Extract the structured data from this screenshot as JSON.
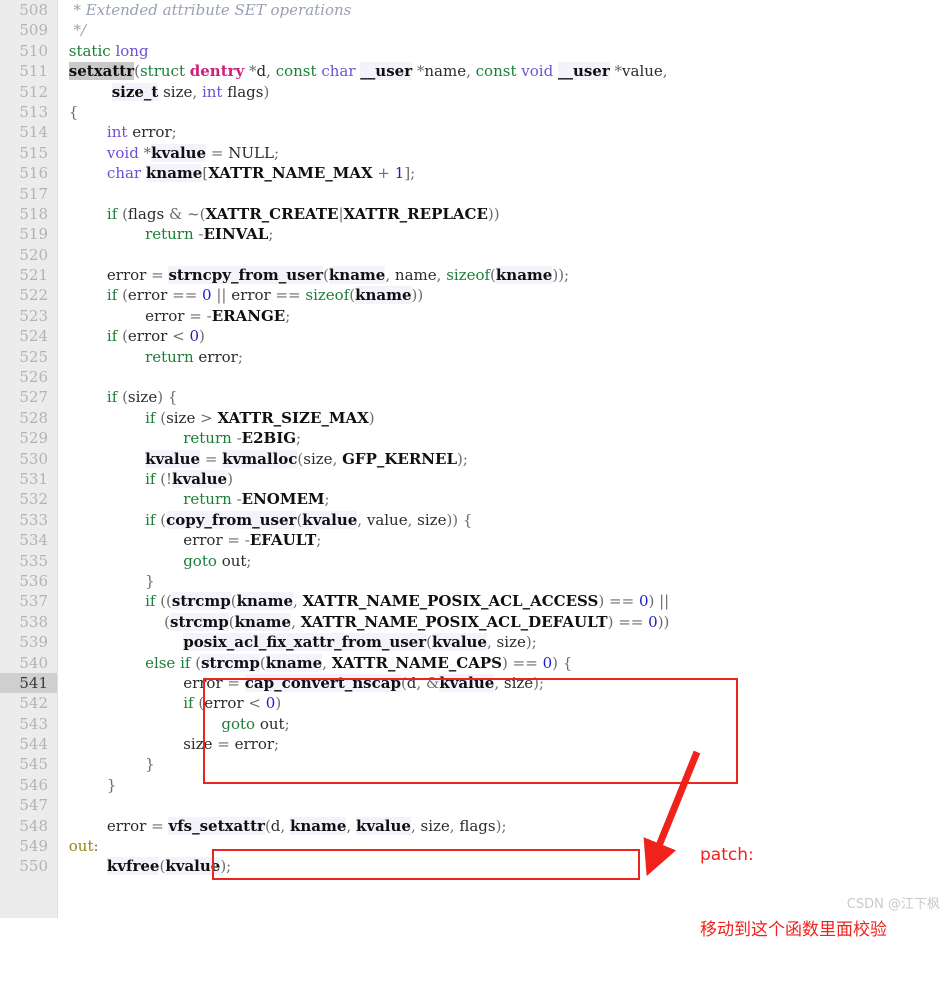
{
  "editor": {
    "language": "c",
    "first_line": 508,
    "last_line": 550,
    "current_line": 541,
    "gutter_bg": "#ececec",
    "current_line_bg": "#cfcfcf",
    "search_highlight_token": "setxattr"
  },
  "line_numbers": [
    "508",
    "509",
    "510",
    "511",
    "512",
    "513",
    "514",
    "515",
    "516",
    "517",
    "518",
    "519",
    "520",
    "521",
    "522",
    "523",
    "524",
    "525",
    "526",
    "527",
    "528",
    "529",
    "530",
    "531",
    "532",
    "533",
    "534",
    "535",
    "536",
    "537",
    "538",
    "539",
    "540",
    "541",
    "542",
    "543",
    "544",
    "545",
    "546",
    "547",
    "548",
    "549",
    "550"
  ],
  "code_lines": [
    {
      "n": "508",
      "text": "  * Extended attribute SET operations"
    },
    {
      "n": "509",
      "text": "  */"
    },
    {
      "n": "510",
      "text": " static long"
    },
    {
      "n": "511",
      "text": " setxattr(struct dentry *d, const char __user *name, const void __user *value,"
    },
    {
      "n": "512",
      "text": "          size_t size, int flags)"
    },
    {
      "n": "513",
      "text": " {"
    },
    {
      "n": "514",
      "text": "         int error;"
    },
    {
      "n": "515",
      "text": "         void *kvalue = NULL;"
    },
    {
      "n": "516",
      "text": "         char kname[XATTR_NAME_MAX + 1];"
    },
    {
      "n": "517",
      "text": ""
    },
    {
      "n": "518",
      "text": "         if (flags & ~(XATTR_CREATE|XATTR_REPLACE))"
    },
    {
      "n": "519",
      "text": "                 return -EINVAL;"
    },
    {
      "n": "520",
      "text": ""
    },
    {
      "n": "521",
      "text": "         error = strncpy_from_user(kname, name, sizeof(kname));"
    },
    {
      "n": "522",
      "text": "         if (error == 0 || error == sizeof(kname))"
    },
    {
      "n": "523",
      "text": "                 error = -ERANGE;"
    },
    {
      "n": "524",
      "text": "         if (error < 0)"
    },
    {
      "n": "525",
      "text": "                 return error;"
    },
    {
      "n": "526",
      "text": ""
    },
    {
      "n": "527",
      "text": "         if (size) {"
    },
    {
      "n": "528",
      "text": "                 if (size > XATTR_SIZE_MAX)"
    },
    {
      "n": "529",
      "text": "                         return -E2BIG;"
    },
    {
      "n": "530",
      "text": "                 kvalue = kvmalloc(size, GFP_KERNEL);"
    },
    {
      "n": "531",
      "text": "                 if (!kvalue)"
    },
    {
      "n": "532",
      "text": "                         return -ENOMEM;"
    },
    {
      "n": "533",
      "text": "                 if (copy_from_user(kvalue, value, size)) {"
    },
    {
      "n": "534",
      "text": "                         error = -EFAULT;"
    },
    {
      "n": "535",
      "text": "                         goto out;"
    },
    {
      "n": "536",
      "text": "                 }"
    },
    {
      "n": "537",
      "text": "                 if ((strcmp(kname, XATTR_NAME_POSIX_ACL_ACCESS) == 0) ||"
    },
    {
      "n": "538",
      "text": "                     (strcmp(kname, XATTR_NAME_POSIX_ACL_DEFAULT) == 0))"
    },
    {
      "n": "539",
      "text": "                         posix_acl_fix_xattr_from_user(kvalue, size);"
    },
    {
      "n": "540",
      "text": "                 else if (strcmp(kname, XATTR_NAME_CAPS) == 0) {"
    },
    {
      "n": "541",
      "text": "                         error = cap_convert_nscap(d, &kvalue, size);"
    },
    {
      "n": "542",
      "text": "                         if (error < 0)"
    },
    {
      "n": "543",
      "text": "                                 goto out;"
    },
    {
      "n": "544",
      "text": "                         size = error;"
    },
    {
      "n": "545",
      "text": "                 }"
    },
    {
      "n": "546",
      "text": "         }"
    },
    {
      "n": "547",
      "text": ""
    },
    {
      "n": "548",
      "text": "         error = vfs_setxattr(d, kname, kvalue, size, flags);"
    },
    {
      "n": "549",
      "text": " out:"
    },
    {
      "n": "550",
      "text": "         kvfree(kvalue);"
    }
  ],
  "annotations": {
    "color": "#f0221c",
    "box_upper": {
      "label": "cap-convert-nscap-block",
      "lines": "540-544"
    },
    "box_lower": {
      "label": "vfs-setxattr-call",
      "lines": "548"
    },
    "arrow": {
      "from_label": "cap-convert-nscap-block",
      "to_label": "vfs-setxattr-call"
    },
    "note_line1": "patch:",
    "note_line2": "移动到这个函数里面校验"
  },
  "watermark": {
    "text": "CSDN @江下枫"
  }
}
